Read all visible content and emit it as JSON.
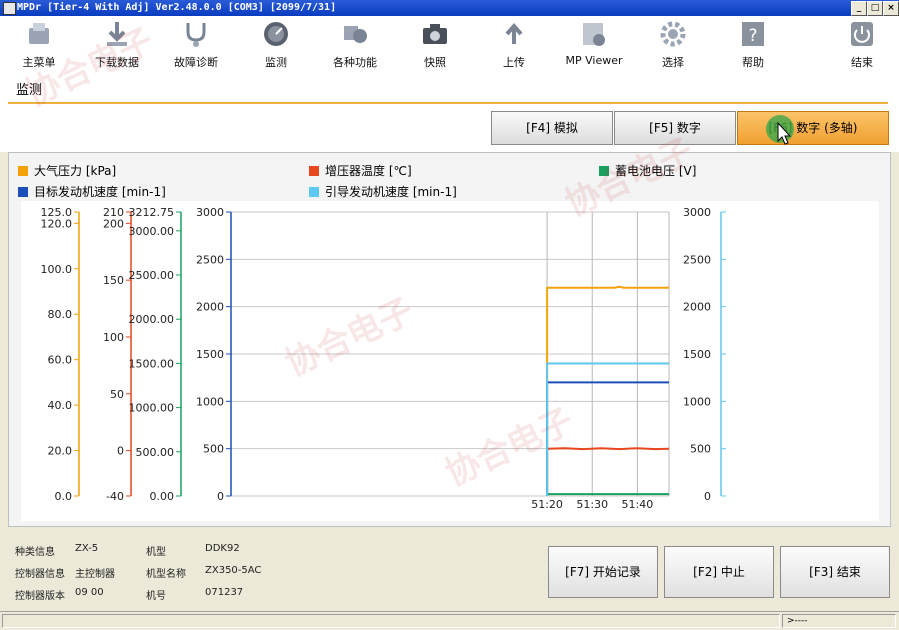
{
  "window": {
    "title": "MPDr [Tier-4 With Adj] Ver2.48.0.0 [COM3] [2099/7/31]",
    "controls": [
      "_",
      "□",
      "×"
    ]
  },
  "toolbar": [
    {
      "label": "主菜单",
      "icon": "main-menu-icon"
    },
    {
      "label": "下载数据",
      "icon": "download-icon"
    },
    {
      "label": "故障诊断",
      "icon": "stethoscope-icon"
    },
    {
      "label": "监测",
      "icon": "gauge-icon"
    },
    {
      "label": "各种功能",
      "icon": "functions-icon"
    },
    {
      "label": "快照",
      "icon": "camera-icon"
    },
    {
      "label": "上传",
      "icon": "upload-icon"
    },
    {
      "label": "MP Viewer",
      "icon": "viewer-icon"
    },
    {
      "label": "选择",
      "icon": "gear-icon"
    },
    {
      "label": "帮助",
      "icon": "help-icon"
    },
    {
      "label": "结束",
      "icon": "power-icon"
    }
  ],
  "section": {
    "title": "监测"
  },
  "tabs": [
    {
      "label": "[F4] 模拟",
      "active": false
    },
    {
      "label": "[F5] 数字",
      "active": false
    },
    {
      "label": "[F6] 数字 (多轴)",
      "active": true
    }
  ],
  "colors": {
    "atm": "#f4a20c",
    "boost": "#e8461e",
    "battery": "#1aa060",
    "target": "#1c4fb8",
    "pilot": "#5ec8ee",
    "accent": "#f0a030"
  },
  "chart_data": {
    "type": "line",
    "legend": [
      {
        "name": "大气压力 [kPa]",
        "color": "#f4a20c"
      },
      {
        "name": "增压器温度 [℃]",
        "color": "#e8461e"
      },
      {
        "name": "蓄电池电压 [V]",
        "color": "#1aa060"
      },
      {
        "name": "目标发动机速度 [min-1]",
        "color": "#1c4fb8"
      },
      {
        "name": "引导发动机速度 [min-1]",
        "color": "#5ec8ee"
      }
    ],
    "axes": [
      {
        "key": "atm",
        "range": [
          0,
          125
        ],
        "ticks": [
          "0.0",
          "20.0",
          "40.0",
          "60.0",
          "80.0",
          "100.0",
          "120.0",
          "125.0"
        ],
        "tick_values": [
          0,
          20,
          40,
          60,
          80,
          100,
          120,
          125
        ],
        "color": "#f4a20c"
      },
      {
        "key": "boost",
        "range": [
          -40,
          210
        ],
        "ticks": [
          "-40",
          "0",
          "50",
          "100",
          "150",
          "200",
          "210"
        ],
        "tick_values": [
          -40,
          0,
          50,
          100,
          150,
          200,
          210
        ],
        "color": "#e8461e"
      },
      {
        "key": "battery",
        "range": [
          0,
          3212.75
        ],
        "ticks": [
          "0.00",
          "500.00",
          "1000.00",
          "1500.00",
          "2000.00",
          "2500.00",
          "3000.00",
          "3212.75"
        ],
        "tick_values": [
          0,
          500,
          1000,
          1500,
          2000,
          2500,
          3000,
          3212.75
        ],
        "color": "#1aa060"
      },
      {
        "key": "rpm_left",
        "range": [
          0,
          3000
        ],
        "ticks": [
          "0",
          "500",
          "1000",
          "1500",
          "2000",
          "2500",
          "3000"
        ],
        "tick_values": [
          0,
          500,
          1000,
          1500,
          2000,
          2500,
          3000
        ],
        "color": "#1c4fb8"
      },
      {
        "key": "rpm_right",
        "range": [
          0,
          3000
        ],
        "ticks": [
          "0",
          "500",
          "1000",
          "1500",
          "2000",
          "2500",
          "3000"
        ],
        "tick_values": [
          0,
          500,
          1000,
          1500,
          2000,
          2500,
          3000
        ],
        "color": "#5ec8ee"
      }
    ],
    "x": {
      "start": "51:20",
      "end": "51:47",
      "ticks": [
        "51:20",
        "51:30",
        "51:40"
      ],
      "tick_values": [
        0,
        10,
        20
      ],
      "range_seconds": [
        -70,
        27
      ]
    },
    "series": [
      {
        "name": "大气压力 [kPa]",
        "axis": "rpm_left",
        "color": "#f4a20c",
        "points": [
          [
            0,
            0
          ],
          [
            0,
            2200
          ],
          [
            15,
            2200
          ],
          [
            16,
            2210
          ],
          [
            17,
            2200
          ],
          [
            27,
            2200
          ]
        ]
      },
      {
        "name": "增压器温度 [℃]",
        "axis": "rpm_left",
        "color": "#e8461e",
        "points": [
          [
            0,
            0
          ],
          [
            0,
            500
          ],
          [
            4,
            505
          ],
          [
            8,
            495
          ],
          [
            12,
            505
          ],
          [
            16,
            495
          ],
          [
            20,
            505
          ],
          [
            24,
            495
          ],
          [
            27,
            500
          ]
        ]
      },
      {
        "name": "蓄电池电压 [V]",
        "axis": "rpm_left",
        "color": "#1aa060",
        "points": [
          [
            0,
            0
          ],
          [
            0,
            20
          ],
          [
            27,
            20
          ]
        ]
      },
      {
        "name": "目标发动机速度 [min-1]",
        "axis": "rpm_left",
        "color": "#1c4fb8",
        "points": [
          [
            0,
            0
          ],
          [
            0,
            1200
          ],
          [
            27,
            1200
          ]
        ]
      },
      {
        "name": "引导发动机速度 [min-1]",
        "axis": "rpm_left",
        "color": "#5ec8ee",
        "points": [
          [
            0,
            0
          ],
          [
            0,
            1400
          ],
          [
            27,
            1400
          ]
        ]
      }
    ],
    "grid": true
  },
  "info": {
    "type_label": "种类信息",
    "type_value": "ZX-5",
    "model_label": "机型",
    "model_value": "DDK92",
    "controller_label": "控制器信息",
    "controller_value": "主控制器",
    "model_name_label": "机型名称",
    "model_name_value": "ZX350-5AC",
    "version_label": "控制器版本",
    "version_value": "09 00",
    "serial_label": "机号",
    "serial_value": "071237"
  },
  "actions": [
    {
      "label": "[F7] 开始记录"
    },
    {
      "label": "[F2] 中止"
    },
    {
      "label": "[F3] 结束"
    }
  ],
  "status": {
    "right": ">----"
  },
  "watermark": "协合电子"
}
